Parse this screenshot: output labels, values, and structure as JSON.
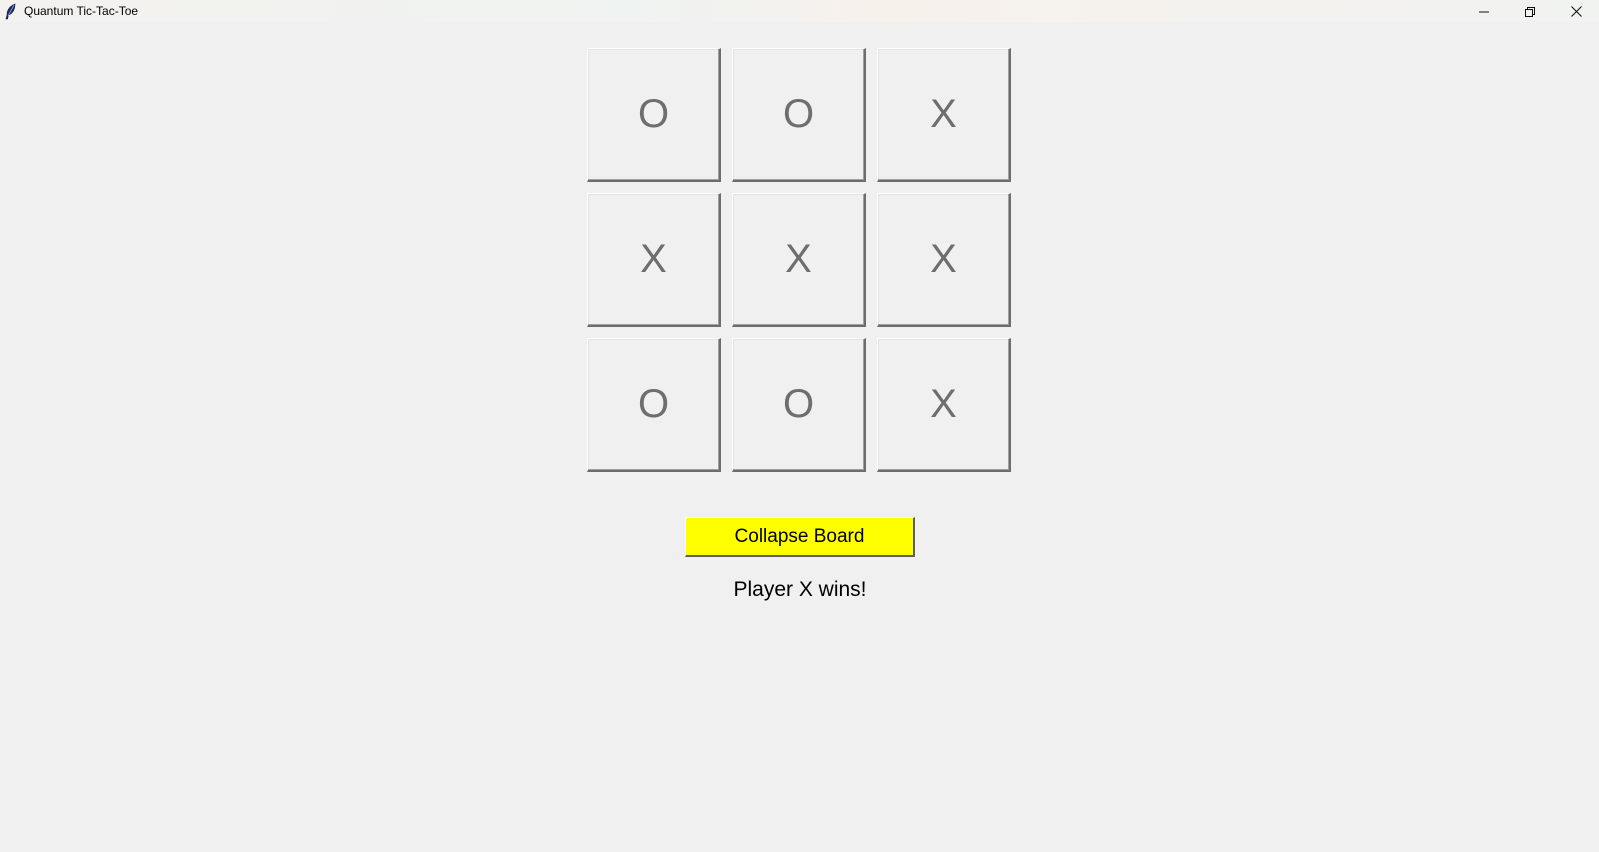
{
  "window": {
    "title": "Quantum Tic-Tac-Toe",
    "icon": "feather-icon",
    "controls": [
      "minimize-icon",
      "restore-icon",
      "close-icon"
    ]
  },
  "board": {
    "cells": [
      [
        "O",
        "O",
        "X"
      ],
      [
        "X",
        "X",
        "X"
      ],
      [
        "O",
        "O",
        "X"
      ]
    ]
  },
  "actions": {
    "collapse_label": "Collapse Board",
    "collapse_color": "#ffff00"
  },
  "status": {
    "message": "Player X wins!"
  }
}
